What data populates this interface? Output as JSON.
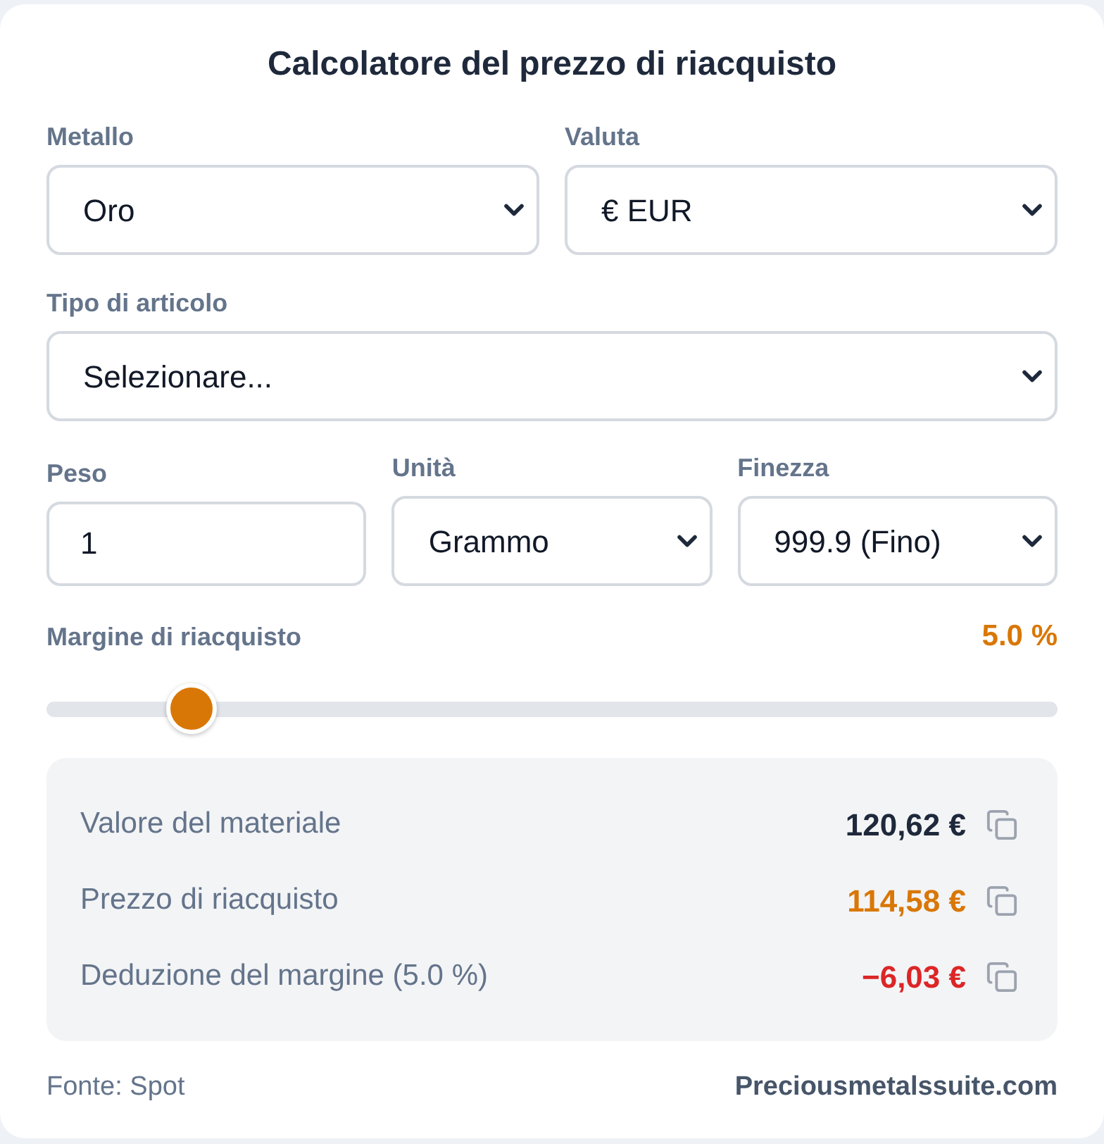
{
  "title": "Calcolatore del prezzo di riacquisto",
  "form_rows": [
    {
      "fields": [
        {
          "kind": "select",
          "label": "Metallo",
          "value": "Oro"
        },
        {
          "kind": "select",
          "label": "Valuta",
          "value": "€ EUR"
        }
      ]
    },
    {
      "fields": [
        {
          "kind": "select",
          "label": "Tipo di articolo",
          "value": "Selezionare..."
        }
      ]
    },
    {
      "fields": [
        {
          "kind": "input",
          "label": "Peso",
          "value": "1"
        },
        {
          "kind": "select",
          "label": "Unità",
          "value": "Grammo"
        },
        {
          "kind": "select",
          "label": "Finezza",
          "value": "999.9 (Fino)"
        }
      ]
    }
  ],
  "margin": {
    "label": "Margine di riacquisto",
    "reading": "5.0 %",
    "level": 0.125
  },
  "results": [
    {
      "label": "Valore del materiale",
      "value": "120,62 €",
      "color": "#1e293b"
    },
    {
      "label": "Prezzo di riacquisto",
      "value": "114,58 €",
      "color": "#d97706"
    },
    {
      "label": "Deduzione del margine (5.0 %)",
      "value": "−6,03 €",
      "color": "#dc2626"
    }
  ],
  "footer": {
    "source": "Fonte: Spot",
    "brand": "Preciousmetalssuite.com"
  }
}
